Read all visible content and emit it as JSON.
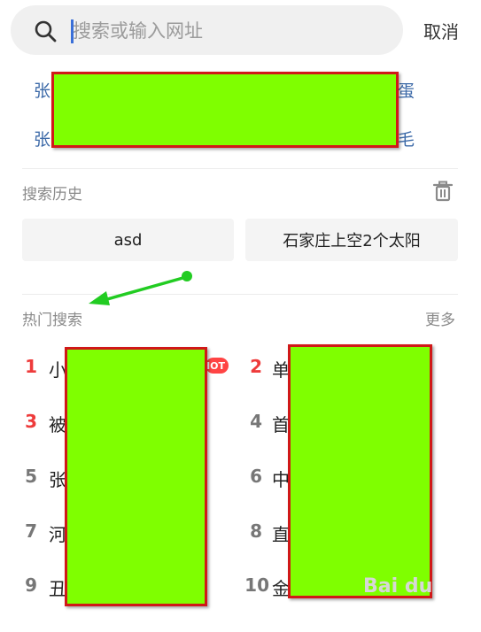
{
  "search": {
    "placeholder": "搜索或输入网址",
    "cancel_label": "取消"
  },
  "suggestions": [
    {
      "left_char": "张",
      "right_char": "蛋"
    },
    {
      "left_char": "张",
      "right_char": "毛"
    }
  ],
  "history": {
    "title": "搜索历史",
    "items": [
      "asd",
      "石家庄上空2个太阳"
    ]
  },
  "hot": {
    "title": "热门搜索",
    "more_label": "更多",
    "badge_label": "HOT",
    "items": [
      {
        "rank": "1",
        "char": "小"
      },
      {
        "rank": "2",
        "char": "单"
      },
      {
        "rank": "3",
        "char": "被"
      },
      {
        "rank": "4",
        "char": "首"
      },
      {
        "rank": "5",
        "char": "张"
      },
      {
        "rank": "6",
        "char": "中"
      },
      {
        "rank": "7",
        "char": "河"
      },
      {
        "rank": "8",
        "char": "直"
      },
      {
        "rank": "9",
        "char": "丑"
      },
      {
        "rank": "10",
        "char": "金"
      }
    ]
  },
  "watermark": "Bai du",
  "colors": {
    "accent": "#3a6fd8",
    "hot_rank": "#ee3b3b",
    "redaction_fill": "#7fff00",
    "redaction_border": "#d01818",
    "annotation_arrow": "#22cc22"
  }
}
